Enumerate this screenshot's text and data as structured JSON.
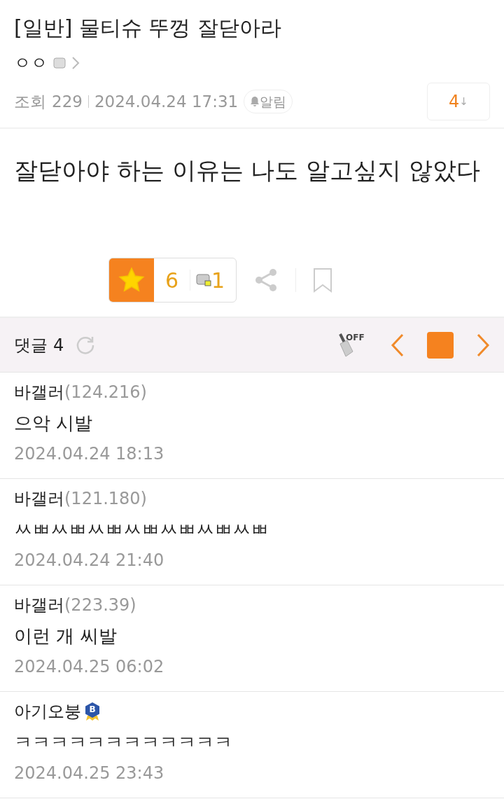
{
  "post": {
    "title": "[일반] 물티슈 뚜껑 잘닫아라",
    "author": "ㅇㅇ",
    "views_label": "조회",
    "views": "229",
    "date": "2024.04.24 17:31",
    "alert_label": "알림",
    "comment_jump": "4",
    "comment_jump_arrow": "↓",
    "body": "잘닫아야 하는 이유는 나도 알고싶지 않았다"
  },
  "reactions": {
    "recommend_selected": true,
    "recommend_count": "6",
    "fixed_count": "1"
  },
  "comments_header": {
    "label": "댓글",
    "count": "4",
    "filter_label": "OFF"
  },
  "comments": [
    {
      "name": "바갤러",
      "ip": "(124.216)",
      "text": "으악 시발",
      "date": "2024.04.24 18:13"
    },
    {
      "name": "바갤러",
      "ip": "(121.180)",
      "text": "ㅆㅃㅆㅃㅆㅃㅆㅃㅆㅃㅆㅃㅆㅃ",
      "date": "2024.04.24 21:40"
    },
    {
      "name": "바갤러",
      "ip": "(223.39)",
      "text": "이런 개 씨발",
      "date": "2024.04.25 06:02"
    },
    {
      "name": "아기오붕",
      "badge": "B",
      "text": "ㅋㅋㅋㅋㅋㅋㅋㅋㅋㅋㅋㅋ",
      "date": "2024.04.25 23:43"
    }
  ]
}
